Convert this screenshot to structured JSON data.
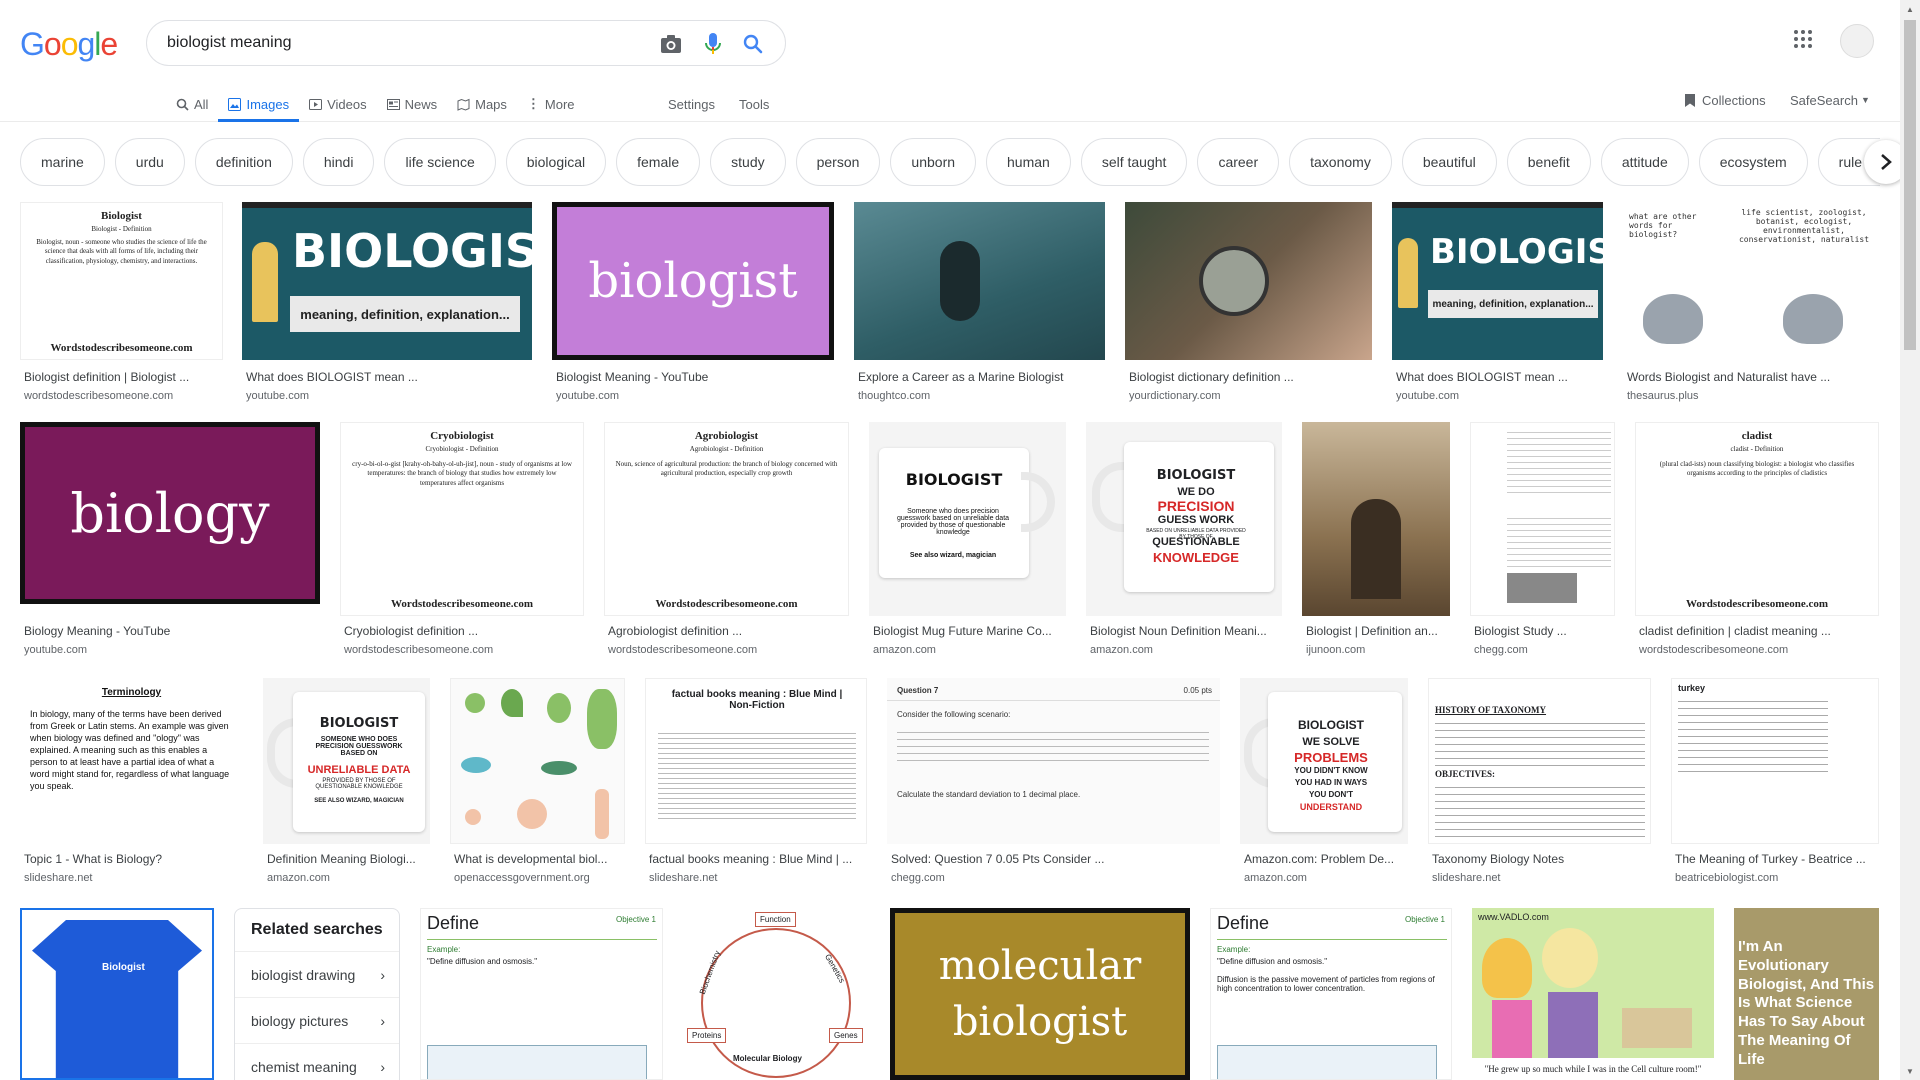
{
  "logo": {
    "letters": [
      "G",
      "o",
      "o",
      "g",
      "l",
      "e"
    ],
    "colors": [
      "#4285f4",
      "#ea4335",
      "#fbbc05",
      "#4285f4",
      "#34a853",
      "#ea4335"
    ]
  },
  "search": {
    "value": "biologist meaning"
  },
  "tabs": [
    {
      "label": "All",
      "icon": "search-icon"
    },
    {
      "label": "Images",
      "icon": "image-icon"
    },
    {
      "label": "Videos",
      "icon": "video-icon"
    },
    {
      "label": "News",
      "icon": "news-icon"
    },
    {
      "label": "Maps",
      "icon": "map-icon"
    },
    {
      "label": "More",
      "icon": "more-icon"
    }
  ],
  "tools": {
    "settings": "Settings",
    "tools": "Tools"
  },
  "collections": "Collections",
  "safesearch": "SafeSearch",
  "chips": [
    "marine",
    "urdu",
    "definition",
    "hindi",
    "life science",
    "biological",
    "female",
    "study",
    "person",
    "unborn",
    "human",
    "self taught",
    "career",
    "taxonomy",
    "beautiful",
    "benefit",
    "attitude",
    "ecosystem",
    "rule the w"
  ],
  "results": [
    {
      "caption": "Biologist definition | Biologist ...",
      "source": "wordstodescribesomeone.com",
      "thumb": {
        "title": "Biologist",
        "sub": "Biologist - Definition",
        "footer": "Wordstodescribesomeone.com"
      }
    },
    {
      "caption": "What does BIOLOGIST mean ...",
      "source": "youtube.com",
      "thumb": {
        "title": "BIOLOGIST",
        "sub": "meaning, definition, explanation..."
      }
    },
    {
      "caption": "Biologist Meaning - YouTube",
      "source": "youtube.com",
      "thumb": {
        "title": "biologist"
      }
    },
    {
      "caption": "Explore a Career as a Marine Biologist",
      "source": "thoughtco.com"
    },
    {
      "caption": "Biologist dictionary definition ...",
      "source": "yourdictionary.com"
    },
    {
      "caption": "What does BIOLOGIST mean ...",
      "source": "youtube.com",
      "thumb": {
        "title": "BIOLOGIST",
        "sub": "meaning, definition, explanation..."
      }
    },
    {
      "caption": "Words Biologist and Naturalist have ...",
      "source": "thesaurus.plus",
      "thumb": {
        "left": "what are other words for biologist?",
        "right": "life scientist, zoologist, botanist, ecologist, environmentalist, conservationist, naturalist"
      }
    },
    {
      "caption": "Biology Meaning - YouTube",
      "source": "youtube.com",
      "thumb": {
        "title": "biology"
      }
    },
    {
      "caption": "Cryobiologist definition ...",
      "source": "wordstodescribesomeone.com",
      "thumb": {
        "title": "Cryobiologist",
        "sub": "Cryobiologist - Definition",
        "footer": "Wordstodescribesomeone.com"
      }
    },
    {
      "caption": "Agrobiologist definition ...",
      "source": "wordstodescribesomeone.com",
      "thumb": {
        "title": "Agrobiologist",
        "sub": "Agrobiologist - Definition",
        "footer": "Wordstodescribesomeone.com"
      }
    },
    {
      "caption": "Biologist Mug Future Marine Co...",
      "source": "amazon.com",
      "thumb": {
        "title": "BIOLOGIST",
        "sub": "Someone who does precision guesswork based on unreliable data provided by those of questionable knowledge",
        "extra": "See also wizard, magician"
      }
    },
    {
      "caption": "Biologist Noun Definition Meani...",
      "source": "amazon.com",
      "thumb": {
        "title": "BIOLOGIST",
        "l1": "WE DO",
        "l2": "PRECISION",
        "l3": "GUESS WORK",
        "l4": "BASED ON UNRELIABLE DATA PROVIDED BY THOSE OF",
        "l5": "QUESTIONABLE",
        "l6": "KNOWLEDGE"
      }
    },
    {
      "caption": "Biologist | Definition an...",
      "source": "ijunoon.com"
    },
    {
      "caption": "Biologist Study ...",
      "source": "chegg.com"
    },
    {
      "caption": "cladist definition | cladist meaning ...",
      "source": "wordstodescribesomeone.com",
      "thumb": {
        "title": "cladist",
        "sub": "cladist - Definition",
        "footer": "Wordstodescribesomeone.com"
      }
    },
    {
      "caption": "Topic 1 - What is Biology?",
      "source": "slideshare.net",
      "thumb": {
        "title": "Terminology"
      }
    },
    {
      "caption": "Definition Meaning Biologi...",
      "source": "amazon.com",
      "thumb": {
        "title": "BIOLOGIST",
        "sub": "SOMEONE WHO DOES PRECISION GUESSWORK BASED ON",
        "l2": "UNRELIABLE DATA",
        "l3": "PROVIDED BY THOSE OF QUESTIONABLE KNOWLEDGE",
        "l4": "SEE ALSO WIZARD, MAGICIAN"
      }
    },
    {
      "caption": "What is developmental biol...",
      "source": "openaccessgovernment.org"
    },
    {
      "caption": "factual books meaning : Blue Mind | ...",
      "source": "slideshare.net",
      "thumb": {
        "title": "factual books meaning : Blue Mind | Non-Fiction"
      }
    },
    {
      "caption": "Solved: Question 7 0.05 Pts Consider ...",
      "source": "chegg.com",
      "thumb": {
        "title": "Question 7",
        "pts": "0.05 pts",
        "body": "Consider the following scenario:",
        "calc": "Calculate the standard deviation to 1 decimal place."
      }
    },
    {
      "caption": "Amazon.com: Problem De...",
      "source": "amazon.com",
      "thumb": {
        "title": "BIOLOGIST",
        "l1": "WE SOLVE",
        "l2": "PROBLEMS",
        "l3": "YOU DIDN'T KNOW",
        "l4": "YOU HAD IN WAYS",
        "l5": "YOU DON'T",
        "l6": "UNDERSTAND"
      }
    },
    {
      "caption": "Taxonomy Biology Notes",
      "source": "slideshare.net",
      "thumb": {
        "title": "HISTORY OF TAXONOMY",
        "obj": "OBJECTIVES:"
      }
    },
    {
      "caption": "The Meaning of Turkey - Beatrice ...",
      "source": "beatricebiologist.com",
      "thumb": {
        "title": "turkey"
      }
    },
    {
      "thumb": {
        "title": "Biologist"
      }
    },
    {
      "thumb": {
        "title": "Define",
        "obj": "Objective 1",
        "ex": "Example:",
        "q": "\"Define diffusion and osmosis.\""
      }
    },
    {
      "thumb": {
        "top": "Function",
        "left": "Biochemistry",
        "right": "Genetics",
        "bl": "Proteins",
        "br": "Genes",
        "bottom": "Molecular Biology"
      }
    },
    {
      "thumb": {
        "l1": "molecular",
        "l2": "biologist"
      }
    },
    {
      "thumb": {
        "title": "Define",
        "obj": "Objective 1",
        "ex": "Example:",
        "q": "\"Define diffusion and osmosis.\"",
        "ans": "Diffusion is the passive movement of particles from regions of high concentration to lower concentration."
      }
    },
    {
      "thumb": {
        "site": "www.VADLO.com",
        "cap": "\"He grew up so much while I was in the Cell culture room!\""
      }
    },
    {
      "thumb": {
        "text": "I'm An Evolutionary Biologist, And This Is What Science Has To Say About The Meaning Of Life"
      }
    }
  ],
  "related": {
    "title": "Related searches",
    "items": [
      "biologist drawing",
      "biology pictures",
      "chemist meaning"
    ]
  }
}
